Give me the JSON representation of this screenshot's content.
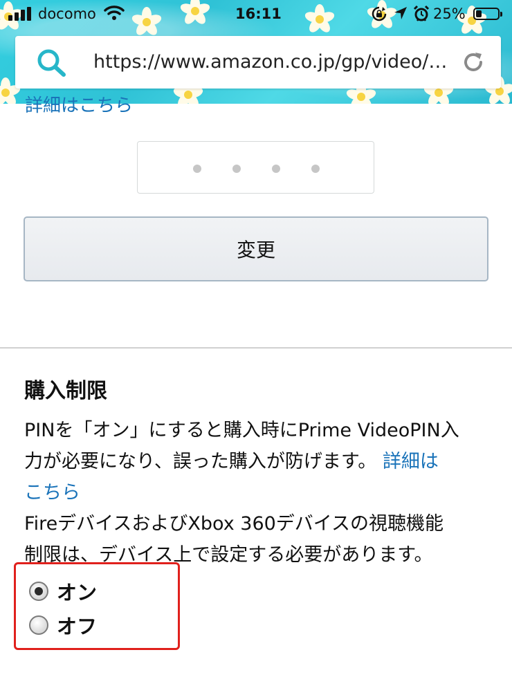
{
  "status_bar": {
    "carrier": "docomo",
    "time": "16:11",
    "battery_percent_label": "25%",
    "battery_level": 0.25,
    "icons": [
      "signal-icon",
      "wifi-icon",
      "rotation-lock-icon",
      "location-icon",
      "alarm-icon",
      "battery-icon"
    ]
  },
  "url_bar": {
    "url": "https://www.amazon.co.jp/gp/video/…",
    "icons": [
      "search-icon",
      "reload-icon"
    ]
  },
  "page": {
    "cut_link": "詳細はこちら",
    "pin_dot_count": 4,
    "change_button": "変更",
    "section_title": "購入制限",
    "desc_line1": "PINを「オン」にすると購入時にPrime VideoPIN入",
    "desc_line2": "力が必要になり、誤った購入が防げます。",
    "desc_link_part1": "詳細は",
    "desc_link_part2": "こちら",
    "desc_line4": "FireデバイスおよびXbox 360デバイスの視聴機能",
    "desc_line5": "制限は、デバイス上で設定する必要があります。",
    "options": [
      {
        "label": "オン",
        "selected": true
      },
      {
        "label": "オフ",
        "selected": false
      }
    ]
  },
  "colors": {
    "link": "#1a73b9",
    "highlight_border": "#e0201c",
    "header_sea": "#34cfe0"
  }
}
